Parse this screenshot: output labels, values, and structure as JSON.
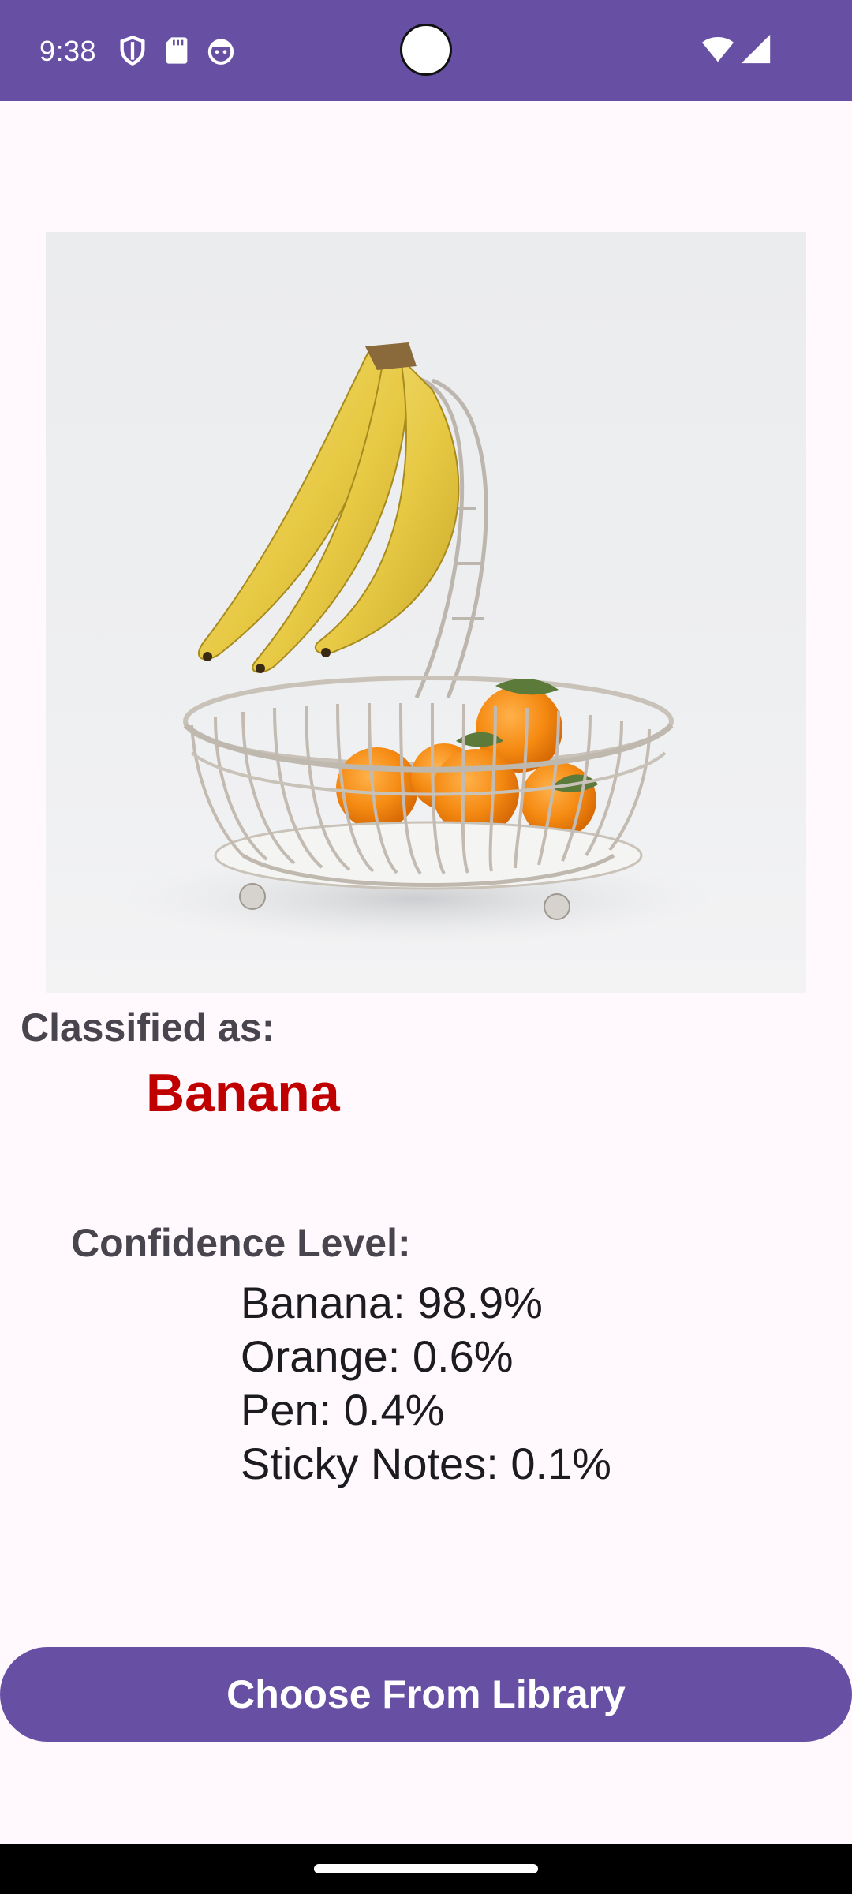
{
  "status_bar": {
    "time": "9:38",
    "icons": [
      "shield-icon",
      "sd-card-icon",
      "face-icon",
      "wifi-icon",
      "signal-icon"
    ],
    "background": "#6750A4"
  },
  "photo": {
    "description_icon": "fruit-basket-image"
  },
  "result": {
    "classified_label": "Classified as:",
    "classified_value": "Banana",
    "value_color": "#C00000"
  },
  "confidence": {
    "label": "Confidence Level:",
    "items": [
      "Banana: 98.9%",
      "Orange: 0.6%",
      "Pen: 0.4%",
      "Sticky Notes: 0.1%"
    ]
  },
  "actions": {
    "choose_label": "Choose From Library",
    "button_color": "#6750A4"
  }
}
